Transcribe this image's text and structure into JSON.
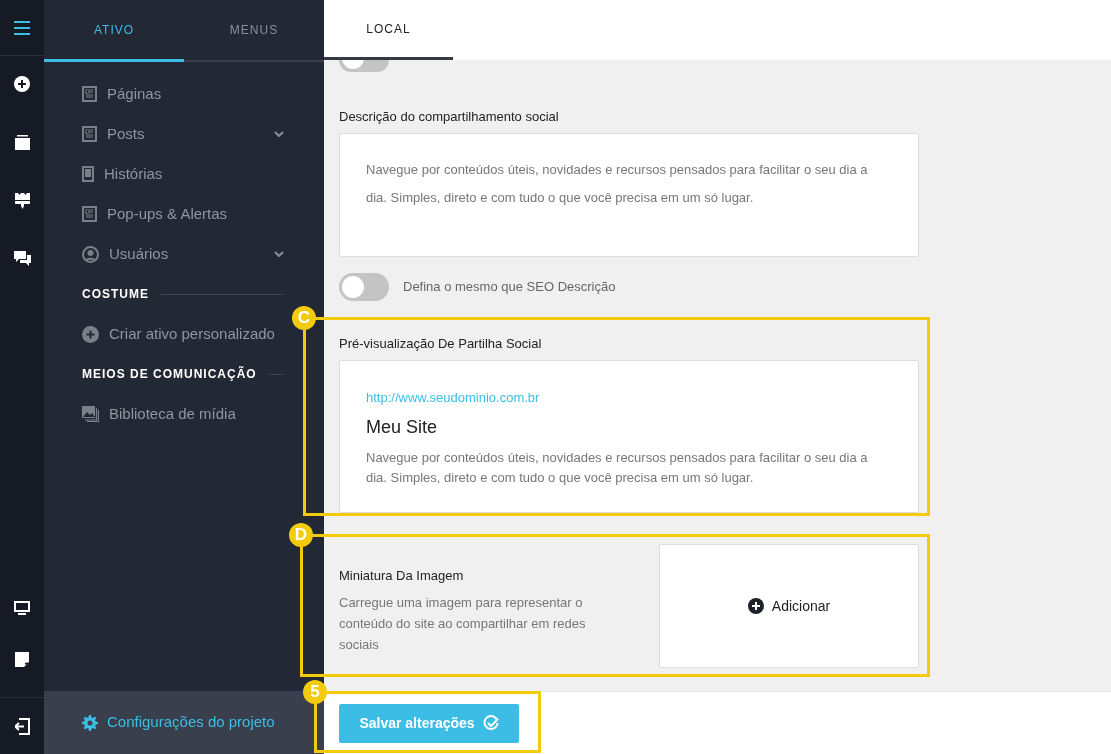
{
  "sidebar": {
    "tabs": [
      {
        "label": "ATIVO",
        "selected": true
      },
      {
        "label": "MENUS",
        "selected": false
      }
    ],
    "items": [
      {
        "kind": "page",
        "label": "Páginas",
        "submenu": false
      },
      {
        "kind": "page",
        "label": "Posts",
        "submenu": true
      },
      {
        "kind": "story",
        "label": "Histórias",
        "submenu": false
      },
      {
        "kind": "page",
        "label": "Pop-ups & Alertas",
        "submenu": false
      },
      {
        "kind": "user",
        "label": "Usuários",
        "submenu": true
      },
      {
        "kind": "header",
        "label": "COSTUME"
      },
      {
        "kind": "add",
        "label": "Criar ativo personalizado",
        "submenu": false
      },
      {
        "kind": "header",
        "label": "MEIOS DE COMUNICAÇÃO"
      },
      {
        "kind": "media",
        "label": "Biblioteca de mídia",
        "submenu": false
      }
    ],
    "settings_link": "Configurações do projeto"
  },
  "content_tabs": [
    {
      "label": "LOCAL",
      "selected": true
    }
  ],
  "top_toggle": {
    "on": false
  },
  "social_description": {
    "label": "Descrição do compartilhamento social",
    "value": "Navegue por conteúdos úteis, novidades e recursos pensados para facilitar o seu dia a dia. Simples, direto e com tudo o que você precisa em um só lugar."
  },
  "description_toggle": {
    "label": "Defina o mesmo que SEO Descrição",
    "on": false
  },
  "preview": {
    "label": "Pré-visualização De Partilha Social",
    "url": "http://www.seudominio.com.br",
    "title": "Meu Site",
    "description": "Navegue por conteúdos úteis, novidades e recursos pensados para facilitar o seu dia a dia. Simples, direto e com tudo o que você precisa em um só lugar."
  },
  "thumbnail": {
    "label": "Miniatura Da Imagem",
    "help": "Carregue uma imagem para representar o conteúdo do site ao compartilhar em redes sociais",
    "add_button": "Adicionar"
  },
  "save_button": "Salvar alterações",
  "annotations": [
    {
      "label": "C"
    },
    {
      "label": "D"
    },
    {
      "label": "5"
    }
  ]
}
